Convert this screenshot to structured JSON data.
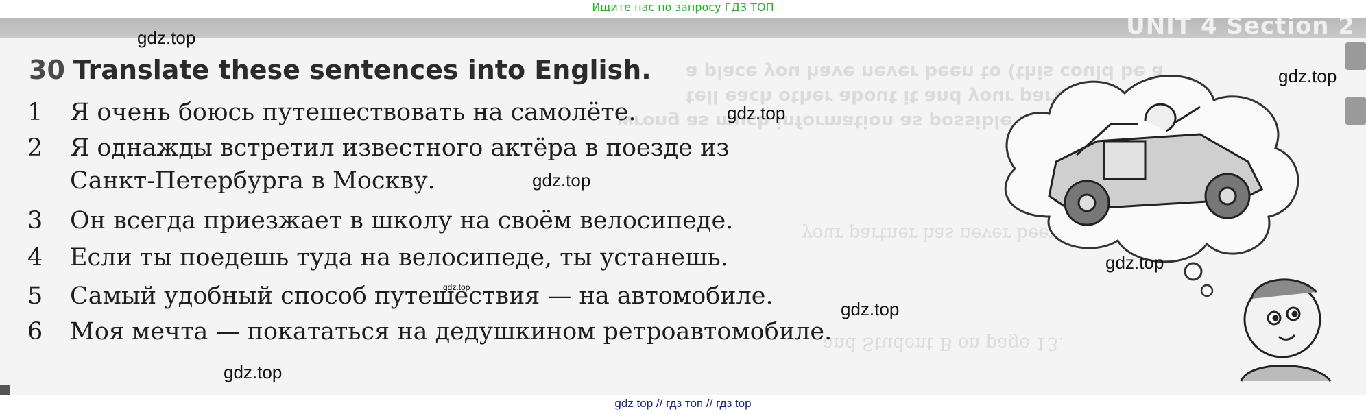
{
  "top_banner": {
    "text": "Ищите нас по запросу ГДЗ ТОП"
  },
  "header": {
    "unit_label": "UNIT 4 Section 2"
  },
  "exercise": {
    "number": "30",
    "title": "Translate these sentences into English.",
    "sentences": [
      {
        "num": "1",
        "lines": [
          "Я очень боюсь путешествовать на самолёте."
        ]
      },
      {
        "num": "2",
        "lines": [
          "Я однажды встретил известного актёра в поезде из",
          "Санкт-Петербурга в Москву."
        ]
      },
      {
        "num": "3",
        "lines": [
          "Он всегда приезжает в школу на своём велосипеде."
        ]
      },
      {
        "num": "4",
        "lines": [
          "Если ты поедешь туда на велосипеде, ты устанешь."
        ]
      },
      {
        "num": "5",
        "lines": [
          "Самый удобный способ путешествия — на автомобиле."
        ]
      },
      {
        "num": "6",
        "lines": [
          "Моя мечта — покататься на дедушкином ретроавтомобиле."
        ]
      }
    ]
  },
  "watermarks": {
    "w1": "gdz.top",
    "w2": "gdz.top",
    "w3": "gdz.top",
    "w4": "gdz.top",
    "w5": "gdz.top",
    "w6": "gdz.top",
    "w7": "gdz.top",
    "w8": "gdz.top"
  },
  "footer": {
    "text": "gdz top  //  гдз топ  //  гдз top"
  },
  "colors": {
    "banner_green": "#1fb31f",
    "footer_navy": "#1a237e",
    "header_band": "#b8b8b8"
  }
}
